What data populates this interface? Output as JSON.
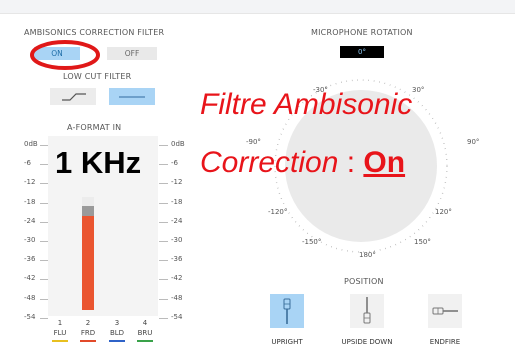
{
  "correction_filter": {
    "title": "AMBISONICS CORRECTION FILTER",
    "on_label": "ON",
    "off_label": "OFF"
  },
  "low_cut": {
    "title": "LOW CUT FILTER"
  },
  "aformat": {
    "title": "A-FORMAT IN",
    "scale": [
      "0dB",
      "-6",
      "-12",
      "-18",
      "-24",
      "-30",
      "-36",
      "-42",
      "-48",
      "-54"
    ],
    "channels": [
      {
        "num": "1",
        "name": "FLU",
        "color": "#e8c020",
        "level": 0
      },
      {
        "num": "2",
        "name": "FRD",
        "color": "#e24a2a",
        "level": 0.72
      },
      {
        "num": "3",
        "name": "BLD",
        "color": "#2f63c8",
        "level": 0
      },
      {
        "num": "4",
        "name": "BRU",
        "color": "#3aa24a",
        "level": 0
      }
    ],
    "meter_color": "#ea5530",
    "peak_color": "#9a9a9a"
  },
  "overlay": {
    "freq": "1 KHz",
    "line1": "Filtre Ambisonic",
    "line2_prefix": "Correction",
    "line2_sep": " : ",
    "line2_value": "On",
    "accent": "#e8141a"
  },
  "rotation": {
    "title": "MICROPHONE ROTATION",
    "value": "0°",
    "ticks": {
      "n30": "-30°",
      "p30": "30°",
      "n90": "-90°",
      "p90": "90°",
      "n120": "-120°",
      "p120": "120°",
      "n150": "-150°",
      "p150": "150°",
      "d180": "180°"
    }
  },
  "position": {
    "title": "POSITION",
    "upright": "UPRIGHT",
    "upside_down": "UPSIDE DOWN",
    "endfire": "ENDFIRE",
    "selected": "UPRIGHT"
  }
}
